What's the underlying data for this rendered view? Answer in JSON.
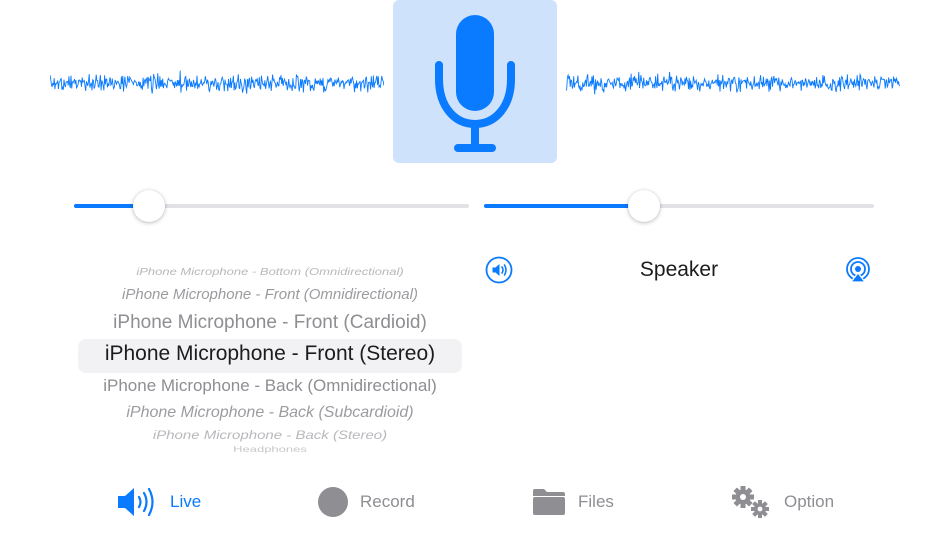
{
  "live": {
    "input_level": 0.19,
    "output_level": 0.41
  },
  "input_picker": {
    "options": [
      "iPhone Microphone - Bottom (Omnidirectional)",
      "iPhone Microphone - Front (Omnidirectional)",
      "iPhone Microphone - Front (Cardioid)",
      "iPhone Microphone - Front (Stereo)",
      "iPhone Microphone - Back (Omnidirectional)",
      "iPhone Microphone - Back (Subcardioid)",
      "iPhone Microphone - Back (Stereo)",
      "Headphones"
    ],
    "selected_index": 3
  },
  "output": {
    "label": "Speaker",
    "volume_icon": "speaker-wave-icon",
    "route_icon": "airplay-icon"
  },
  "tabs": [
    {
      "label": "Live",
      "icon": "speaker-wave-icon",
      "selected": true
    },
    {
      "label": "Record",
      "icon": "record-circle-icon",
      "selected": false
    },
    {
      "label": "Files",
      "icon": "folder-icon",
      "selected": false
    },
    {
      "label": "Option",
      "icon": "gears-icon",
      "selected": false
    }
  ],
  "colors": {
    "accent": "#0a7aff",
    "mic_button_bg": "#cfe2fc",
    "inactive": "#8e8e93",
    "track": "#e2e2e6"
  }
}
